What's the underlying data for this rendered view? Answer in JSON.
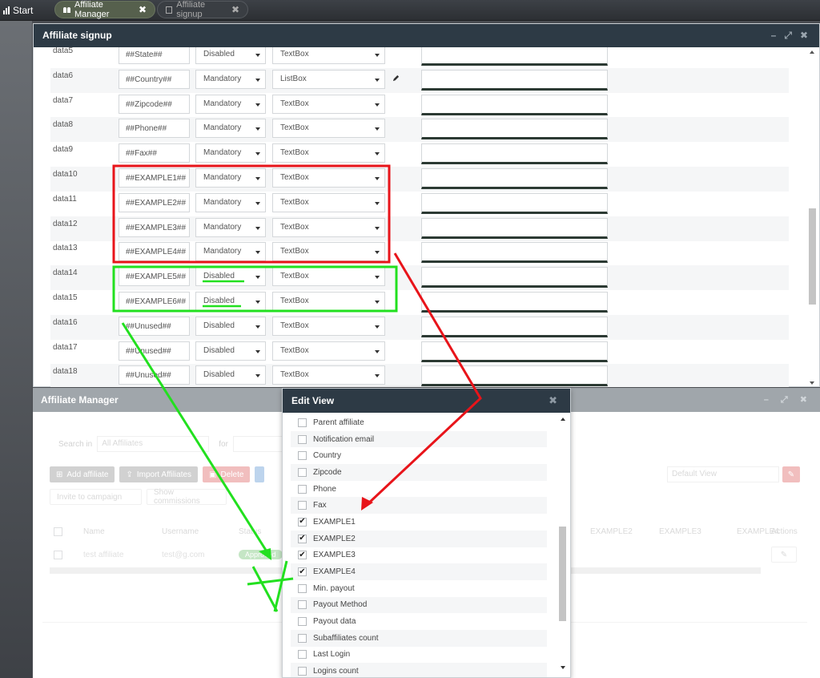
{
  "topbar": {
    "start_label": "Start",
    "tabs": [
      {
        "label": "Affiliate Manager",
        "icon": "users-icon",
        "active": true
      },
      {
        "label": "Affiliate signup",
        "icon": "form-icon",
        "active": false
      }
    ]
  },
  "signup": {
    "title": "Affiliate signup",
    "rows": [
      {
        "name": "data5",
        "code": "##State##",
        "status": "Disabled",
        "type": "TextBox"
      },
      {
        "name": "data6",
        "code": "##Country##",
        "status": "Mandatory",
        "type": "ListBox",
        "editable": true
      },
      {
        "name": "data7",
        "code": "##Zipcode##",
        "status": "Mandatory",
        "type": "TextBox"
      },
      {
        "name": "data8",
        "code": "##Phone##",
        "status": "Mandatory",
        "type": "TextBox"
      },
      {
        "name": "data9",
        "code": "##Fax##",
        "status": "Mandatory",
        "type": "TextBox"
      },
      {
        "name": "data10",
        "code": "##EXAMPLE1##",
        "status": "Mandatory",
        "type": "TextBox"
      },
      {
        "name": "data11",
        "code": "##EXAMPLE2##",
        "status": "Mandatory",
        "type": "TextBox"
      },
      {
        "name": "data12",
        "code": "##EXAMPLE3##",
        "status": "Mandatory",
        "type": "TextBox"
      },
      {
        "name": "data13",
        "code": "##EXAMPLE4##",
        "status": "Mandatory",
        "type": "TextBox"
      },
      {
        "name": "data14",
        "code": "##EXAMPLE5##",
        "status": "Disabled",
        "type": "TextBox"
      },
      {
        "name": "data15",
        "code": "##EXAMPLE6##",
        "status": "Disabled",
        "type": "TextBox"
      },
      {
        "name": "data16",
        "code": "##Unused##",
        "status": "Disabled",
        "type": "TextBox"
      },
      {
        "name": "data17",
        "code": "##Unused##",
        "status": "Disabled",
        "type": "TextBox"
      },
      {
        "name": "data18",
        "code": "##Unused##",
        "status": "Disabled",
        "type": "TextBox"
      }
    ]
  },
  "manager": {
    "title": "Affiliate Manager",
    "search_in_label": "Search in",
    "search_in_value": "All Affiliates",
    "for_label": "for",
    "buttons": {
      "add": "Add affiliate",
      "import": "Import Affiliates",
      "delete": "Delete",
      "invite": "Invite to campaign",
      "commissions": "Show commissions"
    },
    "view_select": "Default View",
    "columns": [
      "Name",
      "Username",
      "Status",
      "EXAMPLE2",
      "EXAMPLE3",
      "EXAMPLE4",
      "Actions"
    ],
    "row": {
      "name": "test affiliate",
      "username": "test@g.com",
      "status": "Approved"
    }
  },
  "editview": {
    "title": "Edit View",
    "items": [
      {
        "label": "Parent affiliate",
        "checked": false
      },
      {
        "label": "Notification email",
        "checked": false
      },
      {
        "label": "Country",
        "checked": false
      },
      {
        "label": "Zipcode",
        "checked": false
      },
      {
        "label": "Phone",
        "checked": false
      },
      {
        "label": "Fax",
        "checked": false
      },
      {
        "label": "EXAMPLE1",
        "checked": true
      },
      {
        "label": "EXAMPLE2",
        "checked": true
      },
      {
        "label": "EXAMPLE3",
        "checked": true
      },
      {
        "label": "EXAMPLE4",
        "checked": true
      },
      {
        "label": "Min. payout",
        "checked": false
      },
      {
        "label": "Payout Method",
        "checked": false
      },
      {
        "label": "Payout data",
        "checked": false
      },
      {
        "label": "Subaffiliates count",
        "checked": false
      },
      {
        "label": "Last Login",
        "checked": false
      },
      {
        "label": "Logins count",
        "checked": false
      }
    ]
  },
  "colors": {
    "title_bar": "#2d3a45",
    "annotation_red": "#e8141a",
    "annotation_green": "#22e01f"
  }
}
